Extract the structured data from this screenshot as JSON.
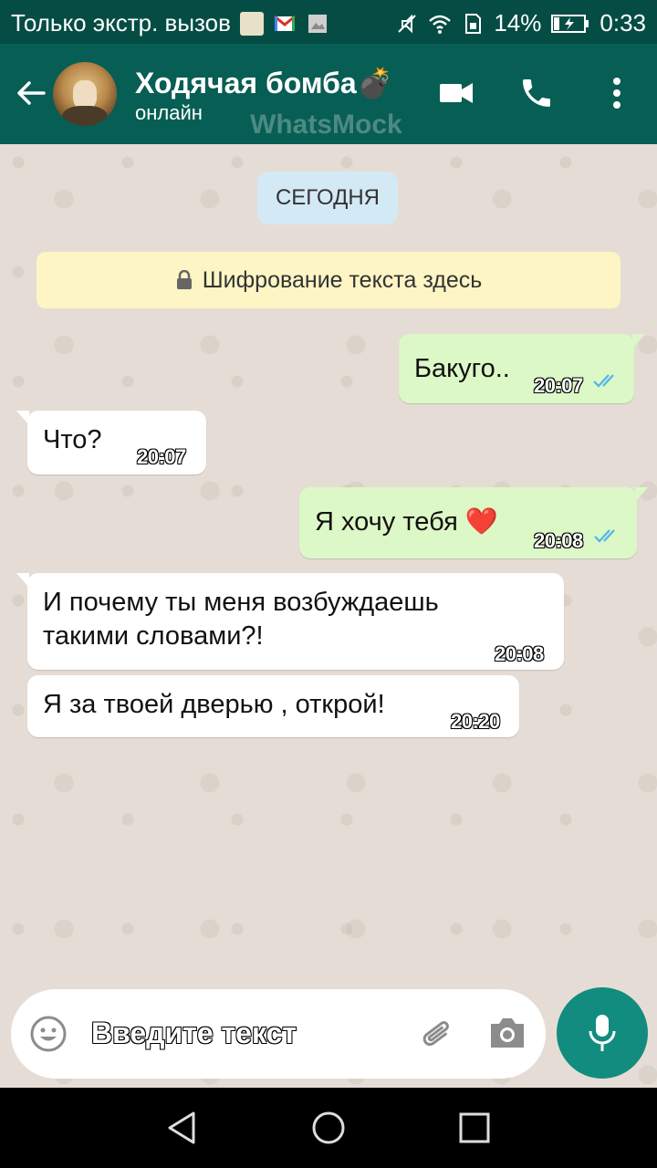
{
  "status_bar": {
    "carrier_text": "Только экстр. вызов",
    "battery": "14%",
    "time": "0:33"
  },
  "header": {
    "contact_name": "Ходячая бомба💣",
    "status": "онлайн",
    "watermark": "WhatsMock"
  },
  "chat": {
    "date_label": "СЕГОДНЯ",
    "encryption_notice": "Шифрование текста здесь",
    "messages": [
      {
        "direction": "outgoing",
        "text": "Бакуго..",
        "time": "20:07",
        "read": true
      },
      {
        "direction": "incoming",
        "text": "Что?",
        "time": "20:07"
      },
      {
        "direction": "outgoing",
        "text": "Я хочу тебя ❤️",
        "time": "20:08",
        "read": true
      },
      {
        "direction": "incoming",
        "text_line1": "И почему ты меня возбуждаешь",
        "text_line2": "такими словами?!",
        "time": "20:08"
      },
      {
        "direction": "incoming",
        "text": "Я за твоей дверью , открой!",
        "time": "20:20"
      }
    ]
  },
  "composer": {
    "placeholder": "Введите текст"
  },
  "colors": {
    "header": "#075e54",
    "statusbar": "#054d44",
    "outgoing_bubble": "#dcf8c6",
    "incoming_bubble": "#ffffff",
    "mic_button": "#128c7e",
    "read_ticks": "#4fb5ec"
  },
  "icons": {
    "header": [
      "back-arrow-icon",
      "video-call-icon",
      "phone-icon",
      "more-vert-icon"
    ],
    "composer": [
      "emoji-icon",
      "attach-icon",
      "camera-icon",
      "mic-icon"
    ],
    "nav": [
      "nav-back-icon",
      "nav-home-icon",
      "nav-recents-icon"
    ]
  }
}
